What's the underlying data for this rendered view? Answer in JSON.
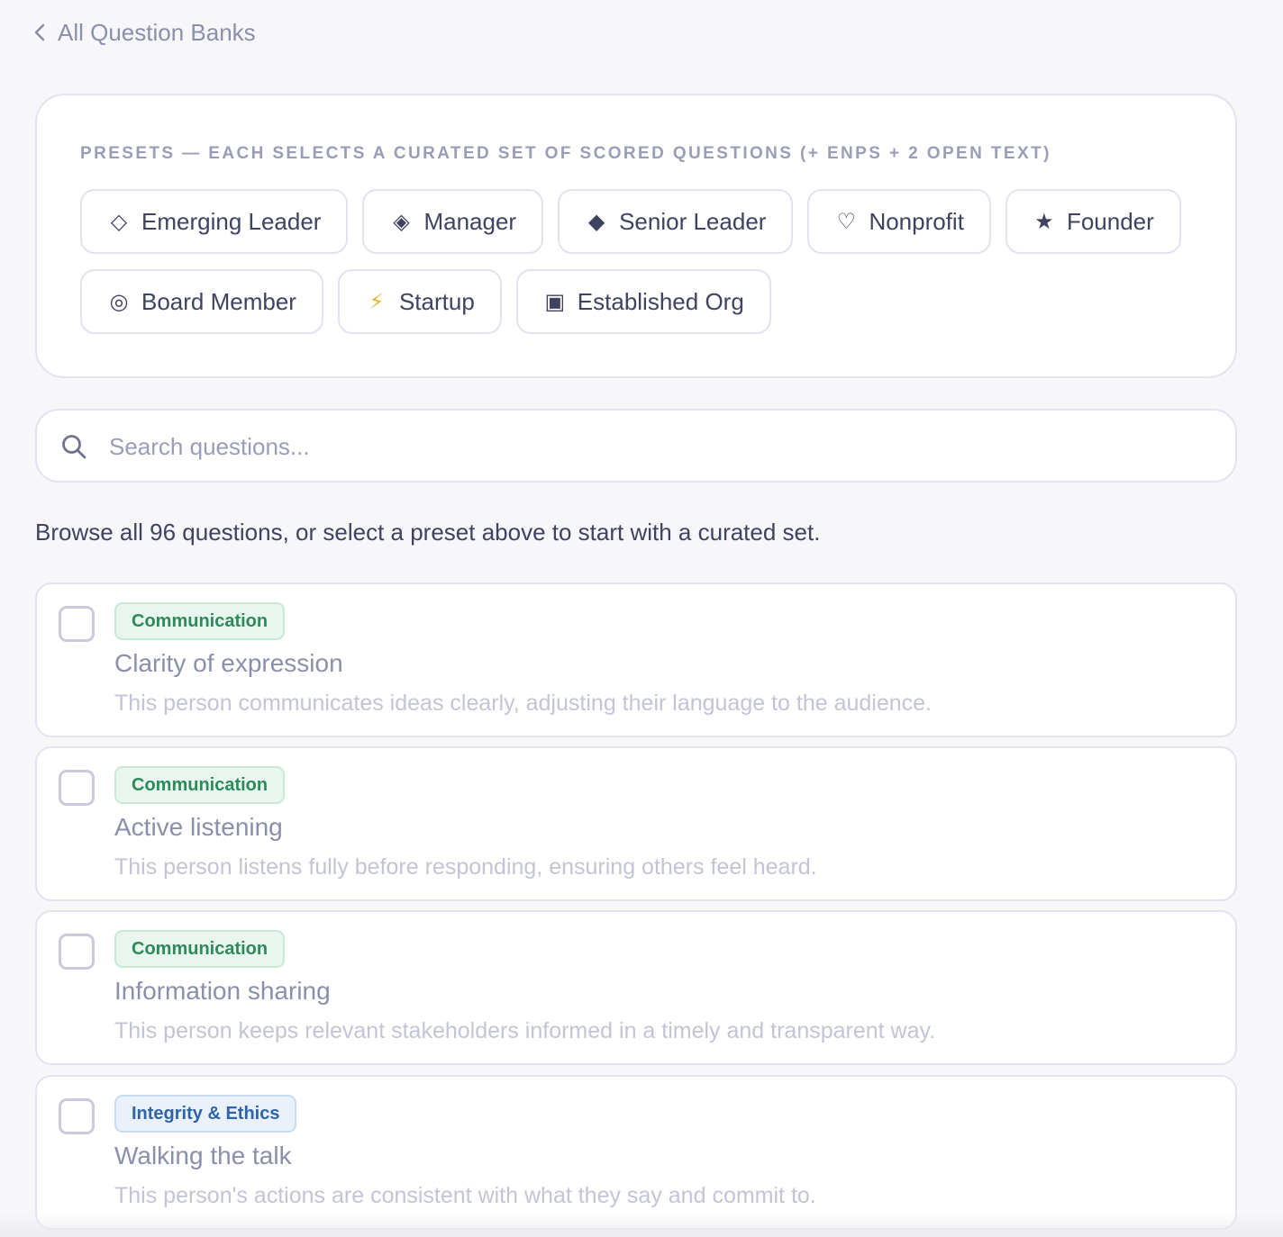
{
  "back_link": {
    "label": "All Question Banks",
    "icon": "chevron-left-icon"
  },
  "presets": {
    "heading": "PRESETS — EACH SELECTS A CURATED SET OF SCORED QUESTIONS (+ ENPS + 2 OPEN TEXT)",
    "items": [
      {
        "glyph": "◇",
        "label": "Emerging Leader",
        "icon": "diamond-outline-icon"
      },
      {
        "glyph": "◈",
        "label": "Manager",
        "icon": "diamond-dot-icon"
      },
      {
        "glyph": "◆",
        "label": "Senior Leader",
        "icon": "diamond-filled-icon"
      },
      {
        "glyph": "♡",
        "label": "Nonprofit",
        "icon": "heart-icon"
      },
      {
        "glyph": "★",
        "label": "Founder",
        "icon": "star-icon"
      },
      {
        "glyph": "◎",
        "label": "Board Member",
        "icon": "bullseye-icon"
      },
      {
        "glyph": "⚡",
        "label": "Startup",
        "icon": "lightning-icon"
      },
      {
        "glyph": "▣",
        "label": "Established Org",
        "icon": "square-icon"
      }
    ]
  },
  "search": {
    "placeholder": "Search questions..."
  },
  "helper_text": "Browse all 96 questions, or select a preset above to start with a curated set.",
  "questions": [
    {
      "tag": "Communication",
      "tag_color": "#2d8a5a",
      "title": "Clarity of expression",
      "description": "This person communicates ideas clearly, adjusting their language to the audience."
    },
    {
      "tag": "Communication",
      "tag_color": "#2d8a5a",
      "title": "Active listening",
      "description": "This person listens fully before responding, ensuring others feel heard."
    },
    {
      "tag": "Communication",
      "tag_color": "#2d8a5a",
      "title": "Information sharing",
      "description": "This person keeps relevant stakeholders informed in a timely and transparent way."
    },
    {
      "tag": "Integrity & Ethics",
      "tag_color": "#2f64a7",
      "title": "Walking the talk",
      "description": "This person's actions are consistent with what they say and commit to."
    }
  ]
}
